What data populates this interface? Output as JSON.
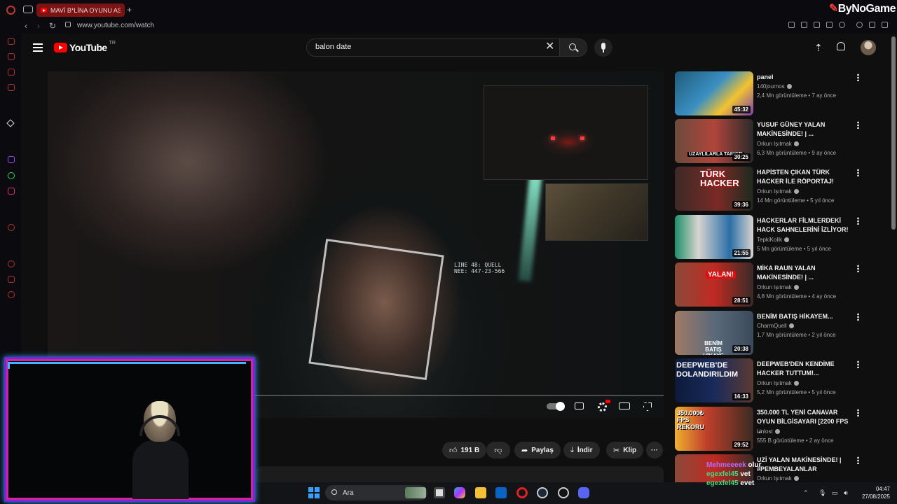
{
  "browser": {
    "tab_title": "MAVİ B*LİNA OYUNU ASL",
    "new_tab_symbol": "+",
    "url": "www.youtube.com/watch",
    "brand_watermark": "ByNoGame"
  },
  "youtube": {
    "logo_text": "YouTube",
    "region": "TR",
    "search_value": "balon date"
  },
  "player": {
    "scan_label_line1": "LINE 48: QUELL",
    "scan_label_line2": "NEE: 447-23-566"
  },
  "actions": {
    "like_count": "191 B",
    "share": "Paylaş",
    "download": "İndir",
    "clip": "Klip",
    "more": "···"
  },
  "recommendations": [
    {
      "title": "panel",
      "channel": "140journos",
      "meta": "2,4 Mn görüntüleme • 7 ay önce",
      "duration": "45:32"
    },
    {
      "title": "YUSUF GÜNEY YALAN MAKİNESİNDE! | ...",
      "channel": "Orkun Işıtmak",
      "meta": "6,3 Mn görüntüleme • 9 ay önce",
      "duration": "30:25",
      "thumb_text": "UZAYLILARLA TANIŞTI"
    },
    {
      "title": "HAPİSTEN ÇIKAN TÜRK HACKER İLE RÖPORTAJ!",
      "channel": "Orkun Işıtmak",
      "meta": "14 Mn görüntüleme • 5 yıl önce",
      "duration": "39:36",
      "thumb_text": "TÜRK HACKER"
    },
    {
      "title": "HACKERLAR FİLMLERDEKİ HACK SAHNELERİNİ İZLİYOR!",
      "channel": "TepkiKolik",
      "meta": "5 Mn görüntüleme • 5 yıl önce",
      "duration": "21:55"
    },
    {
      "title": "MİKA RAUN YALAN MAKİNESİNDE! | ...",
      "channel": "Orkun Işıtmak",
      "meta": "4,8 Mn görüntüleme • 4 ay önce",
      "duration": "28:51",
      "thumb_text": "YALAN!"
    },
    {
      "title": "BENİM BATIŞ HİKAYEM...",
      "channel": "CharmQuell",
      "meta": "1,7 Mn görüntüleme • 2 yıl önce",
      "duration": "20:38",
      "thumb_text": "BENİM BATIŞ HİKAYE"
    },
    {
      "title": "DEEPWEB'DEN KENDİME HACKER TUTTUM!...",
      "channel": "Orkun Işıtmak",
      "meta": "5,2 Mn görüntüleme • 5 yıl önce",
      "duration": "16:33",
      "thumb_text": "DEEPWEB'DE DOLANDIRILDIM"
    },
    {
      "title": "350.000 TL YENİ CANAVAR OYUN BİLGİSAYARI [2200 FPS ...",
      "channel": "Unlost",
      "meta": "555 B görüntüleme • 2 ay önce",
      "duration": "29:52",
      "thumb_text": "350.000₺ FPS REKORU"
    },
    {
      "title": "UZİ YALAN MAKİNESİNDE! | #PEMBEYALANLAR",
      "channel": "Orkun Işıtmak",
      "meta": "",
      "duration": ""
    }
  ],
  "chat": [
    {
      "user": "Mehmeeeek",
      "message": "olur"
    },
    {
      "user": "egexfel45",
      "message": "vet"
    },
    {
      "user": "egexfel45",
      "message": "evet"
    }
  ],
  "taskbar": {
    "search_label": "Ara",
    "time": "04:47",
    "date": "27/08/2025"
  },
  "colors": {
    "youtube_red": "#ff0000",
    "tab_active": "#7a1414",
    "cam_border_purple": "#6e2bd9",
    "cam_border_pink": "#d2239a",
    "chat_user_purple": "#b06cff",
    "chat_user_green": "#3ddc84"
  }
}
